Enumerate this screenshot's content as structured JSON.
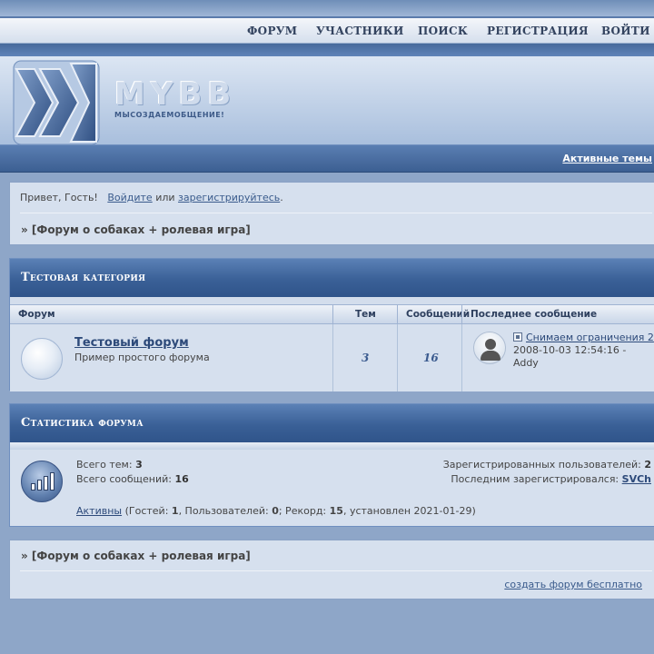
{
  "top_menu": {
    "items": [
      "ФОРУМ",
      "УЧАСТНИКИ",
      "ПОИСК",
      "РЕГИСТРАЦИЯ",
      "ВОЙТИ"
    ]
  },
  "logo": {
    "text": "MYBB",
    "slogan": "МЫСОЗДАЕМОБЩЕНИЕ!"
  },
  "subnav": {
    "active_topics": "Активные темы"
  },
  "welcome": {
    "greeting": "Привет, Гость!",
    "login_link": "Войдите",
    "or_text": "или",
    "register_link": "зарегистрируйтесь",
    "end": "."
  },
  "breadcrumb": "» [Форум о собаках + ролевая игра]",
  "category": {
    "title": "Тестовая категория",
    "columns": {
      "forum": "Форум",
      "topics": "Тем",
      "posts": "Сообщений",
      "last_post": "Последнее сообщение"
    },
    "forums": [
      {
        "title": "Тестовый форум",
        "description": "Пример простого форума",
        "topics": "3",
        "posts": "16",
        "last_post_title": "Снимаем ограничения 2",
        "last_post_date": "2008-10-03 12:54:16 -",
        "last_post_author": "Addy"
      }
    ]
  },
  "stats": {
    "title": "Статистика форума",
    "total_topics_label": "Всего тем:",
    "total_topics": "3",
    "total_posts_label": "Всего сообщений:",
    "total_posts": "16",
    "registered_label": "Зарегистрированных пользователей:",
    "registered": "2",
    "last_registered_label": "Последним зарегистрировался:",
    "last_registered": "SVCh",
    "online_link": "Активны",
    "online_guests_label": "(Гостей:",
    "online_guests": "1",
    "online_users_label": ", Пользователей:",
    "online_users": "0",
    "online_record_label": "; Рекорд:",
    "online_record": "15",
    "online_record_date": ", установлен 2021-01-29)"
  },
  "footer": {
    "create_forum": "создать форум бесплатно"
  }
}
